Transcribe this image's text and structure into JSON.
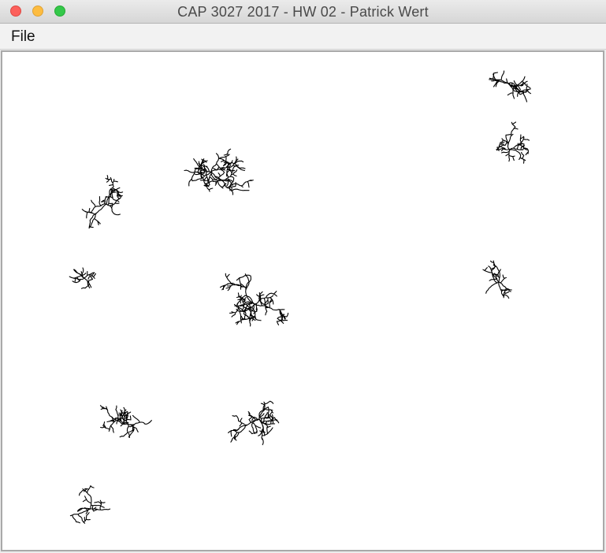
{
  "window": {
    "title": "CAP 3027 2017 - HW 02 - Patrick Wert",
    "buttons": [
      "close",
      "minimize",
      "zoom"
    ]
  },
  "menu": {
    "items": [
      {
        "label": "File"
      }
    ]
  },
  "canvas": {
    "background": "#ffffff",
    "stroke_color": "#000000",
    "content": "diffusion-limited aggregation clusters",
    "cluster_count": 11
  }
}
